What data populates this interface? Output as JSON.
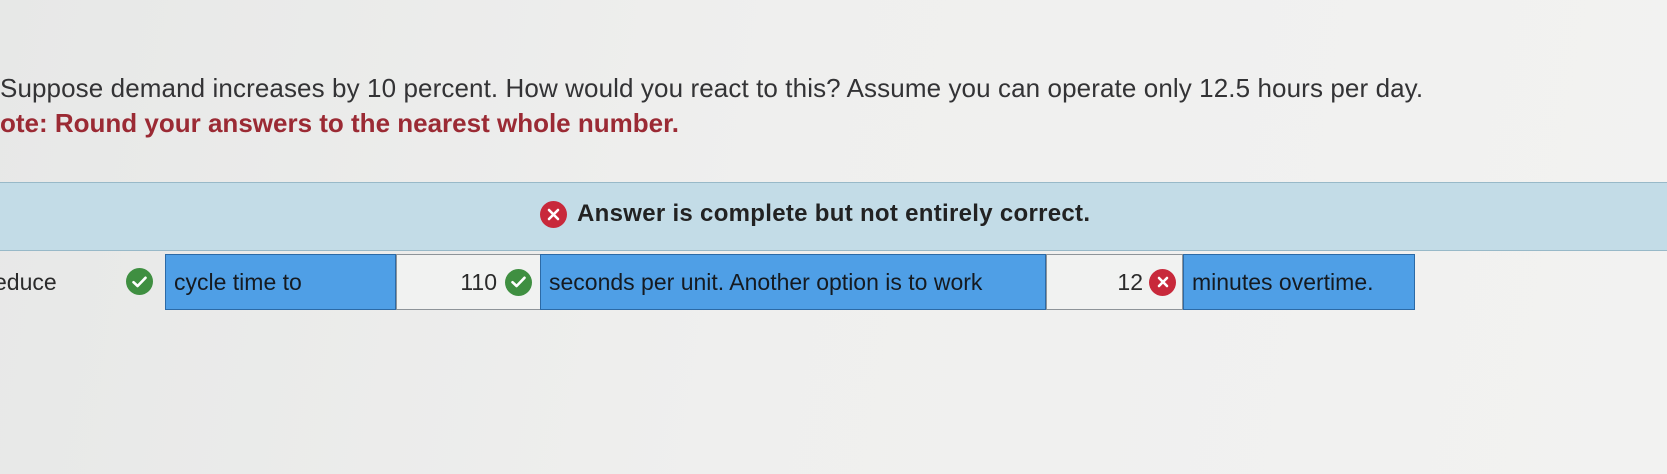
{
  "question": {
    "text": "Suppose demand increases by 10 percent. How would you react to this? Assume you can operate only 12.5 hours per day.",
    "note": "ote: Round your answers to the nearest whole number."
  },
  "feedback": {
    "icon": "x-circle-icon",
    "color": "#c8293b",
    "message": "Answer is complete but not entirely correct."
  },
  "answer_row": {
    "option_word": "educe",
    "option_status": "correct",
    "phrase1": "cycle time to",
    "value1": "110",
    "value1_status": "correct",
    "phrase2": "seconds per unit. Another option is to work",
    "value2": "12",
    "value2_status": "incorrect",
    "phrase3": "minutes overtime."
  },
  "colors": {
    "correct": "#3f8f41",
    "incorrect": "#c8293b",
    "blank_fill": "#4f9fe6",
    "banner": "#c3dce7",
    "note_text": "#9b2a34"
  }
}
